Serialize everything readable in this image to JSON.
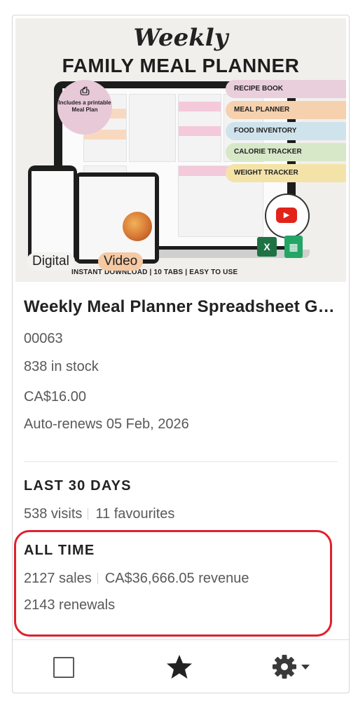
{
  "listing": {
    "thumbnail": {
      "script_title": "Weekly",
      "headline": "FAMILY MEAL PLANNER",
      "badge_text": "Includes a printable Meal Plan",
      "pills": [
        {
          "label": "RECIPE BOOK",
          "color": "#e9cfdc"
        },
        {
          "label": "MEAL PLANNER",
          "color": "#f6d1ae"
        },
        {
          "label": "FOOD INVENTORY",
          "color": "#cfe3ec"
        },
        {
          "label": "CALORIE TRACKER",
          "color": "#d7e8c9"
        },
        {
          "label": "WEIGHT TRACKER",
          "color": "#f4e3a8"
        }
      ],
      "footer_text": "INSTANT DOWNLOAD | 10 TABS | EASY TO USE",
      "tags": [
        "Digital",
        "Video"
      ]
    },
    "title": "Weekly Meal Planner Spreadsheet Google Sheets Excel",
    "sku": "00063",
    "stock": "838 in stock",
    "price": "CA$16.00",
    "renews": "Auto-renews 05 Feb, 2026"
  },
  "last_30_days": {
    "heading": "LAST 30 DAYS",
    "visits": "538 visits",
    "favourites": "11 favourites"
  },
  "all_time": {
    "heading": "ALL TIME",
    "sales": "2127 sales",
    "revenue": "CA$36,666.05 revenue",
    "renewals": "2143 renewals",
    "highlight_color": "#e0202e"
  },
  "toolbar": {
    "checkbox_icon": "checkbox-icon",
    "star_icon": "star-icon",
    "gear_icon": "gear-icon"
  }
}
